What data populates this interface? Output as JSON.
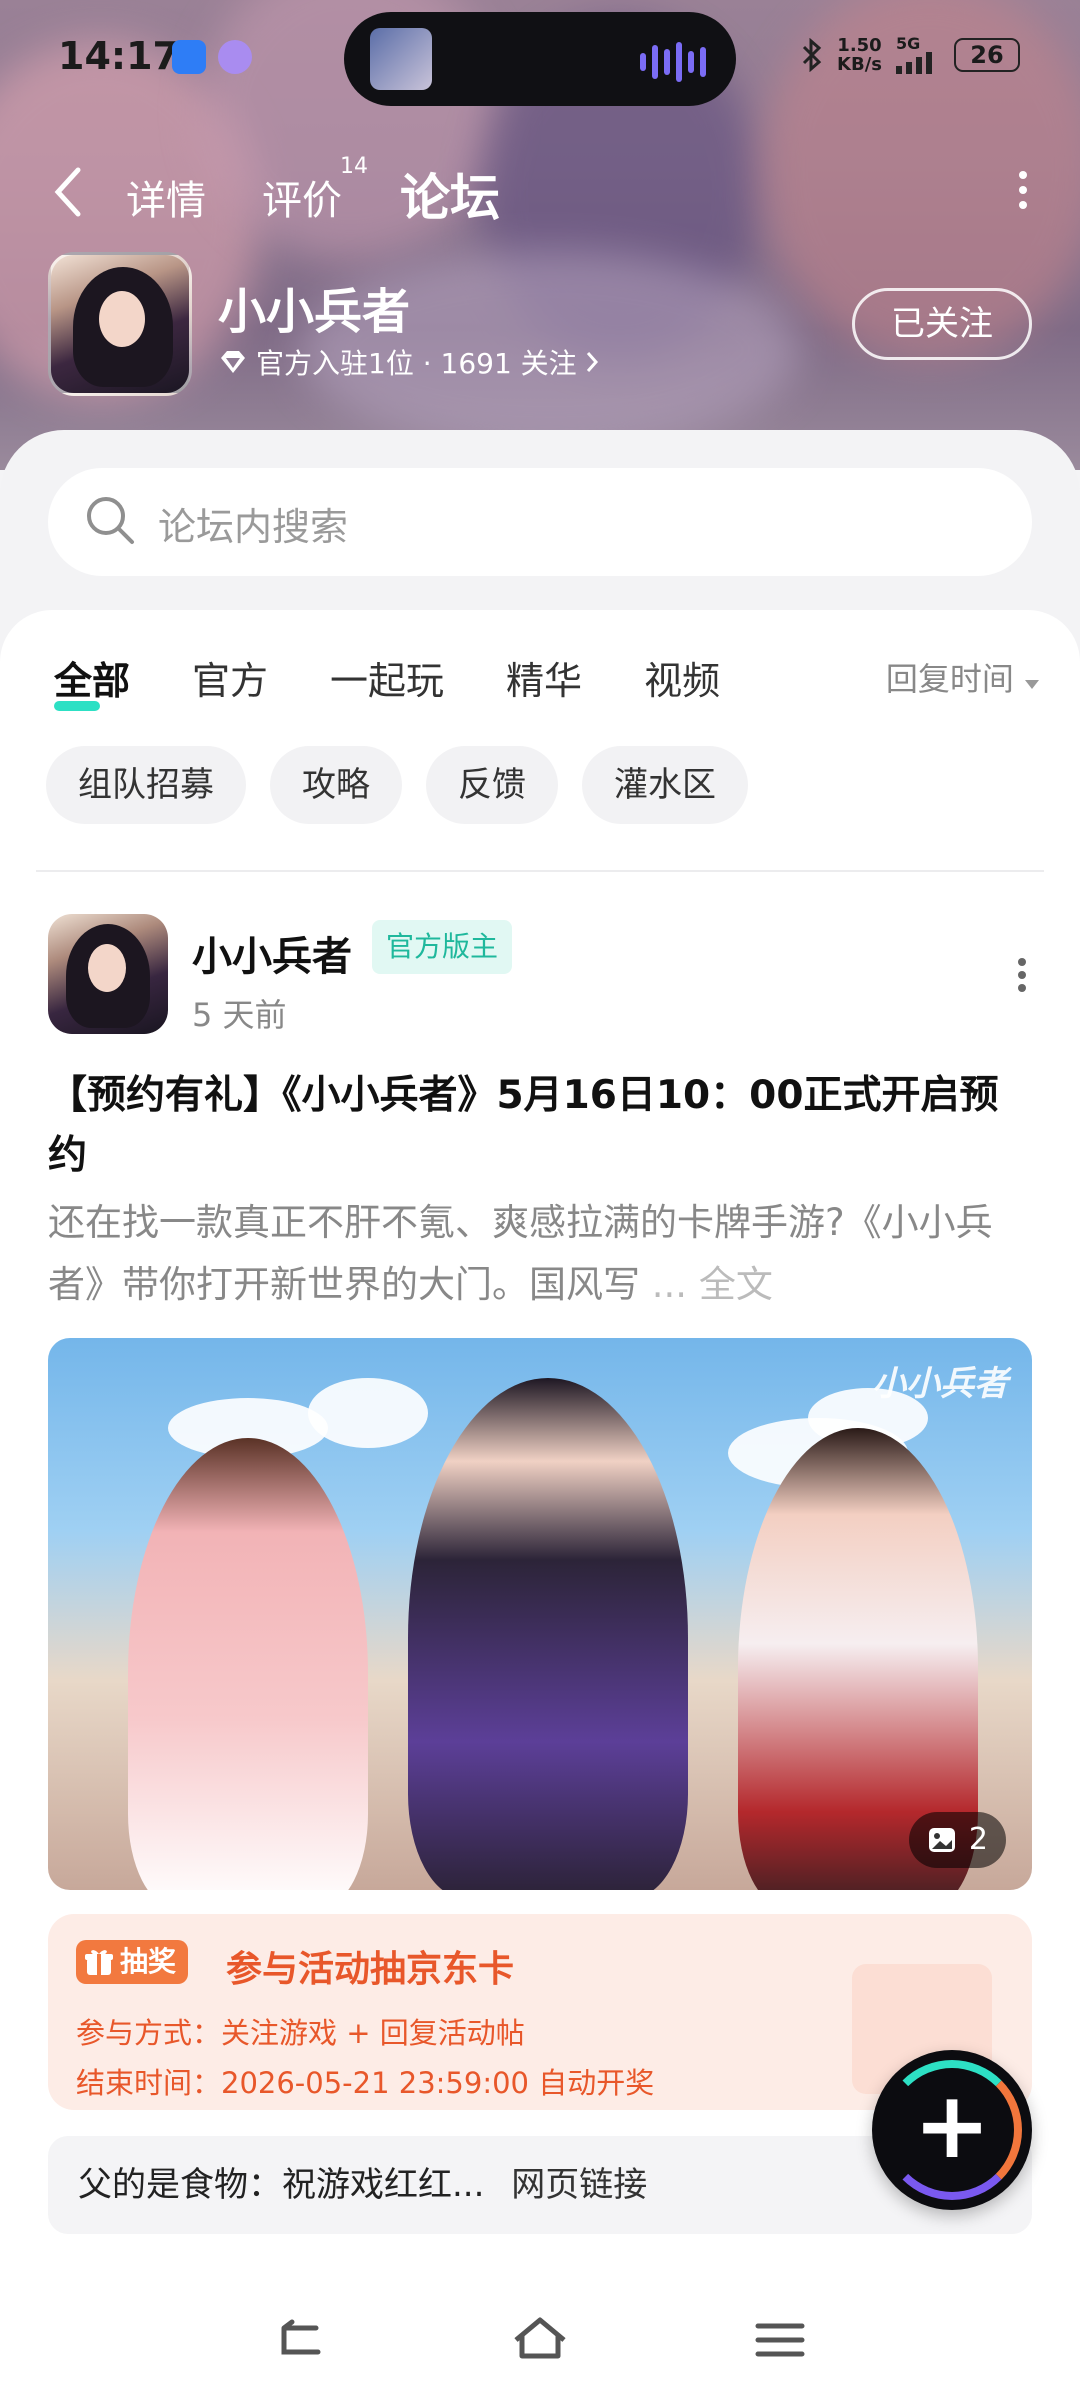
{
  "status_bar": {
    "time": "14:17",
    "speed_value": "1.50",
    "speed_unit": "KB/s",
    "network": "5G",
    "battery": "26"
  },
  "nav": {
    "tabs": [
      {
        "label": "详情"
      },
      {
        "label": "评价",
        "count": "14"
      },
      {
        "label": "论坛"
      }
    ],
    "active_tab": "论坛"
  },
  "game": {
    "name": "小小兵者",
    "meta": "官方入驻1位 · 1691 关注",
    "follow_label": "已关注"
  },
  "search": {
    "placeholder": "论坛内搜索"
  },
  "category_tabs": [
    "全部",
    "官方",
    "一起玩",
    "精华",
    "视频"
  ],
  "sort_label": "回复时间",
  "chips": [
    "组队招募",
    "攻略",
    "反馈",
    "灌水区"
  ],
  "post": {
    "author": "小小兵者",
    "badge": "官方版主",
    "time": "5 天前",
    "title": "【预约有礼】《小小兵者》5月16日10：00正式开启预约",
    "excerpt": "还在找一款真正不肝不氪、爽感拉满的卡牌手游?《小小兵者》带你打开新世界的大门。国风写",
    "ellipsis": "...",
    "full_text": "全文",
    "image_logo": "小小兵者",
    "image_count": "2"
  },
  "promo": {
    "tag": "抽奖",
    "title": "参与活动抽京东卡",
    "method": "参与方式：关注游戏 + 回复活动帖",
    "end_time": "结束时间：2026-05-21 23:59:00 自动开奖"
  },
  "comment": {
    "text": "父的是食物：祝游戏红红...",
    "link": "网页链接"
  },
  "colors": {
    "accent": "#2de0c4",
    "promo": "#e8572a",
    "badge_bg": "#e1f8f3"
  }
}
